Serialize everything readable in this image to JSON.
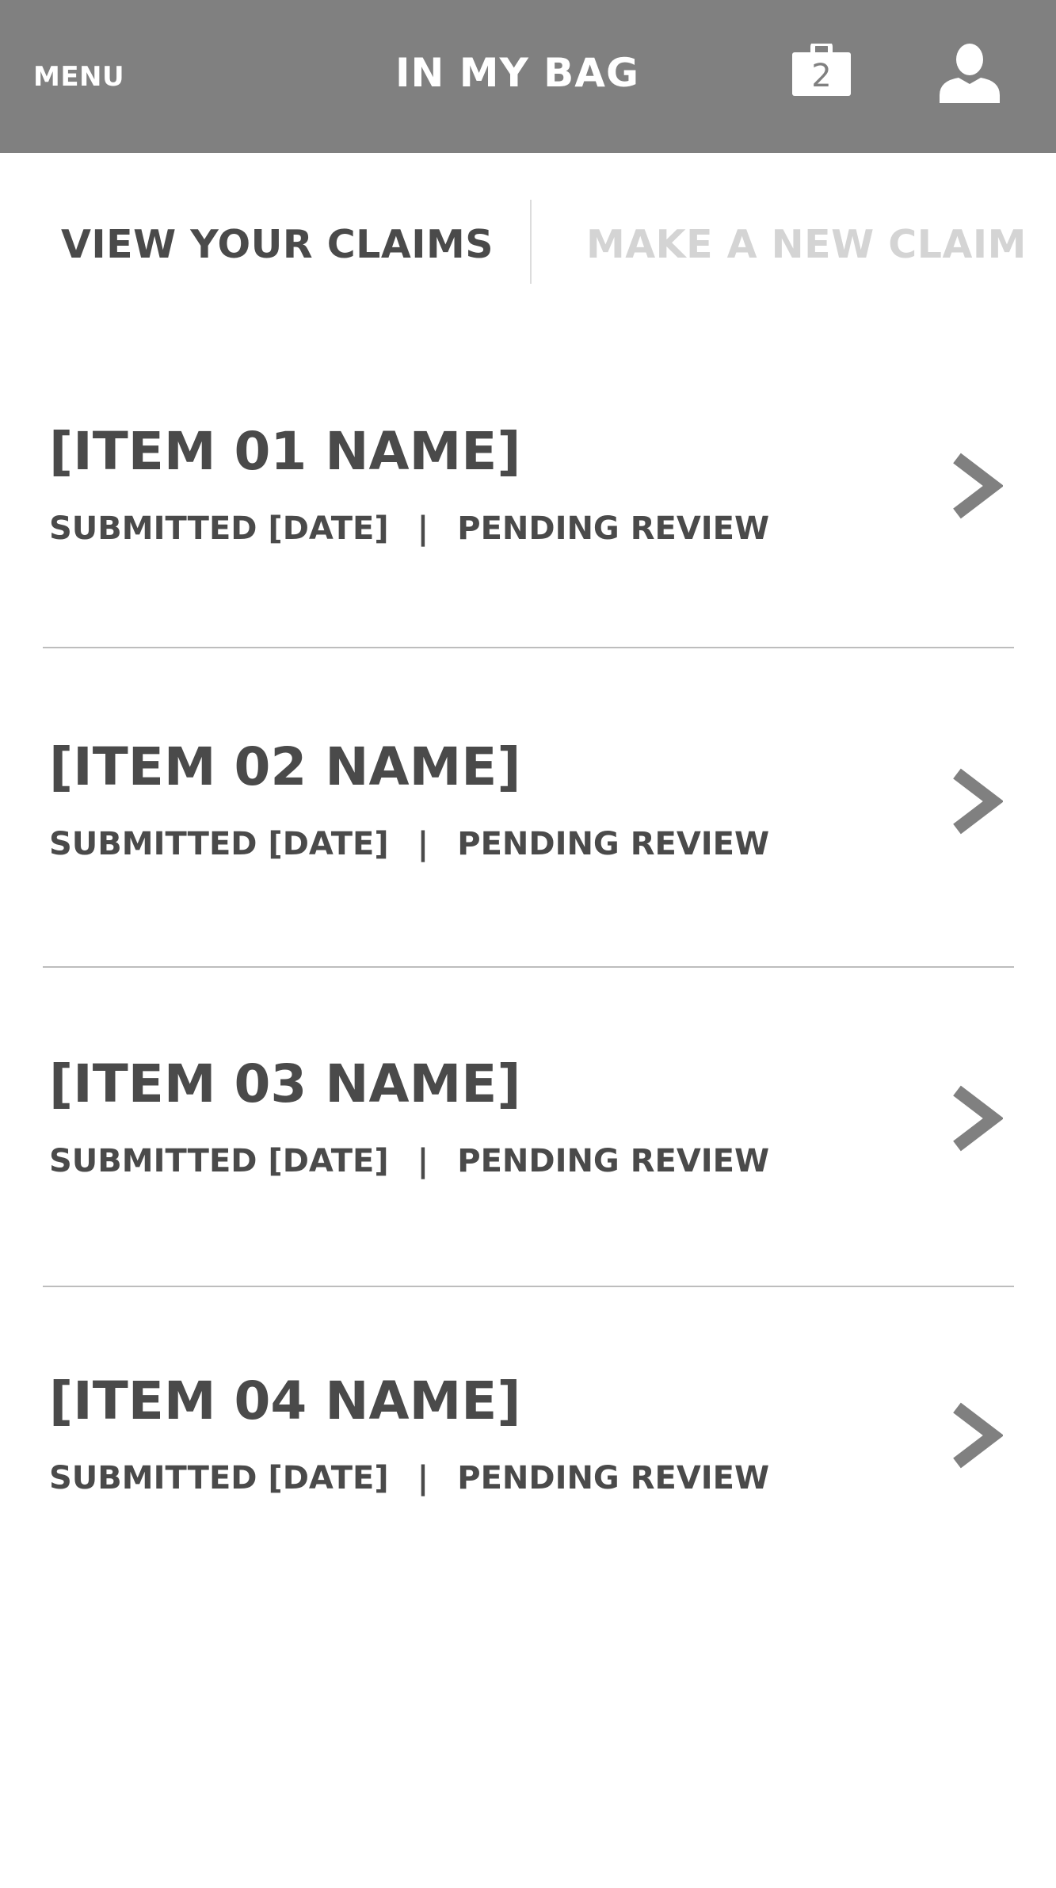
{
  "header": {
    "menu_label": "MENU",
    "title": "IN MY BAG",
    "bag_count": "2",
    "background_color": "#808080"
  },
  "tabs": {
    "active_label": "VIEW YOUR CLAIMS",
    "inactive_label": "MAKE A NEW CLAIM"
  },
  "claims": [
    {
      "name": "[ITEM 01 NAME]",
      "submitted": "SUBMITTED [DATE]",
      "separator": "|",
      "status": "PENDING REVIEW"
    },
    {
      "name": "[ITEM 02 NAME]",
      "submitted": "SUBMITTED [DATE]",
      "separator": "|",
      "status": "PENDING REVIEW"
    },
    {
      "name": "[ITEM 03 NAME]",
      "submitted": "SUBMITTED [DATE]",
      "separator": "|",
      "status": "PENDING REVIEW"
    },
    {
      "name": "[ITEM 04 NAME]",
      "submitted": "SUBMITTED [DATE]",
      "separator": "|",
      "status": "PENDING REVIEW"
    }
  ],
  "icons": {
    "bag": "bag-icon",
    "profile": "user-icon",
    "row_arrow": "chevron-right-icon"
  }
}
